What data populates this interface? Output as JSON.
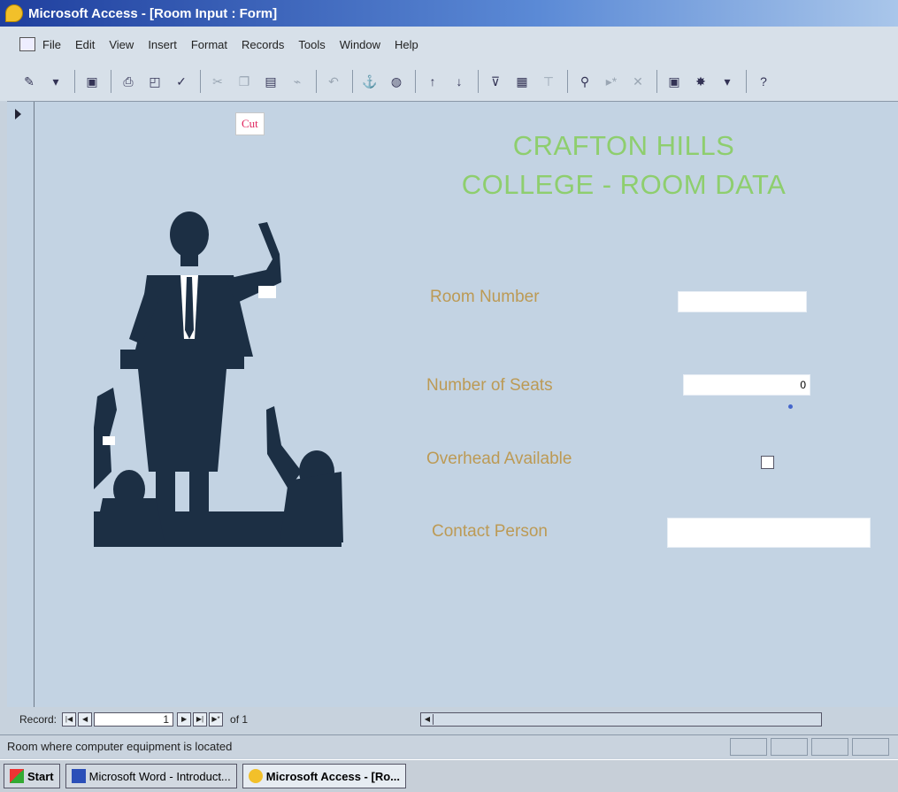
{
  "window": {
    "title": "Microsoft Access - [Room Input : Form]"
  },
  "menubar": {
    "items": [
      "File",
      "Edit",
      "View",
      "Insert",
      "Format",
      "Records",
      "Tools",
      "Window",
      "Help"
    ]
  },
  "tooltip": {
    "text": "Cut"
  },
  "form": {
    "title_line1": "CRAFTON HILLS",
    "title_line2": "COLLEGE - ROOM DATA",
    "fields": {
      "room_number": {
        "label": "Room Number",
        "value": ""
      },
      "number_of_seats": {
        "label": "Number of Seats",
        "value": "0"
      },
      "overhead_available": {
        "label": "Overhead Available",
        "checked": false
      },
      "contact_person": {
        "label": "Contact Person",
        "value": ""
      }
    }
  },
  "navigation": {
    "record_label": "Record:",
    "current": "1",
    "of_text": "of 1"
  },
  "status": {
    "text": "Room where computer equipment is located"
  },
  "taskbar": {
    "start": "Start",
    "tasks": [
      "Microsoft Word - Introduct...",
      "Microsoft Access - [Ro..."
    ]
  },
  "colors": {
    "title_text": "#8ece6e",
    "label_text": "#bc9a55",
    "form_background": "#c3d3e3",
    "titlebar": "#1f3f9e"
  }
}
